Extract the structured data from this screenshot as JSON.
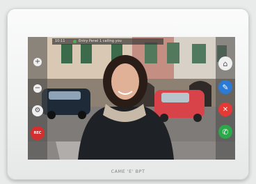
{
  "notification": {
    "time": "10:11",
    "message": "Entry Panel 1 calling you"
  },
  "left_controls": [
    {
      "name": "volume-up-button",
      "symbol": "+"
    },
    {
      "name": "volume-down-button",
      "symbol": "−"
    },
    {
      "name": "settings-button",
      "symbol": "⚙"
    },
    {
      "name": "record-button",
      "symbol": "REC"
    }
  ],
  "right_controls": [
    {
      "name": "camera-switch-button",
      "symbol": "⌂"
    },
    {
      "name": "pen-button",
      "symbol": "✎"
    },
    {
      "name": "lock-button",
      "symbol": "✕"
    },
    {
      "name": "answer-call-button",
      "symbol": "✆"
    }
  ],
  "brand_label": "CAME 'E' BPT",
  "colors": {
    "record": "#d32f2f",
    "answer": "#2aa84a",
    "hangup": "#e53935",
    "pen": "#2b7bd6"
  }
}
